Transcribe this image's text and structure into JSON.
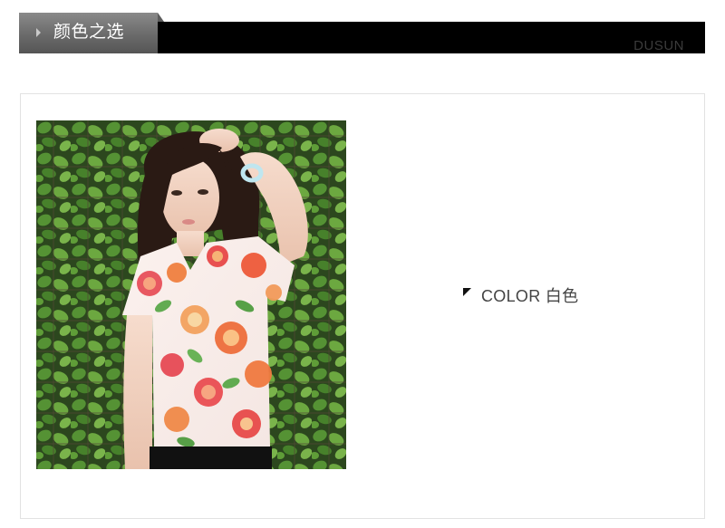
{
  "header": {
    "title": "颜色之选",
    "brand": "DUSUN",
    "arrow_icon": "triangle-right-icon"
  },
  "product": {
    "image_alt": "model wearing floral print v-neck t-shirt in front of ivy-covered wall",
    "color_label": "COLOR 白色",
    "color_icon": "corner-triangle-icon"
  },
  "colors": {
    "header_black": "#000000",
    "tab_gray": "#6a6a6a",
    "frame_border": "#e2e2e2",
    "text_dark": "#444444"
  }
}
